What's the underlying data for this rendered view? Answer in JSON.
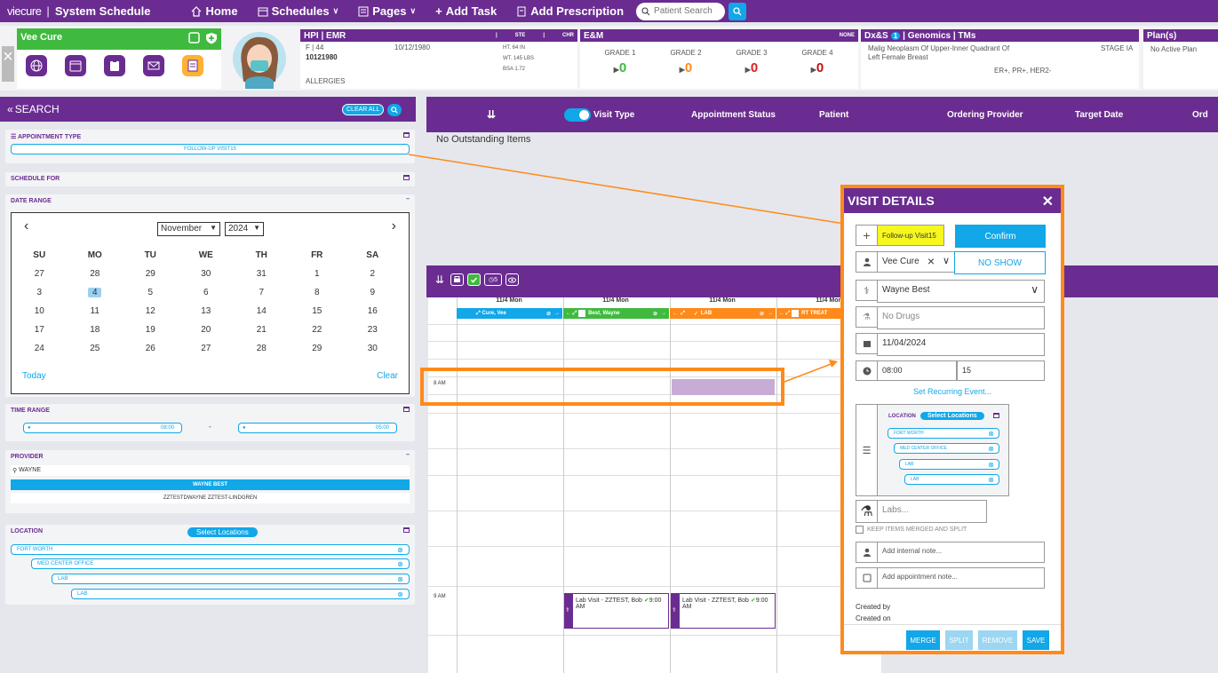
{
  "nav": {
    "logo": "viecure",
    "title": "System Schedule",
    "home": "Home",
    "schedules": "Schedules",
    "pages": "Pages",
    "add_task": "Add Task",
    "add_prescription": "Add Prescription",
    "search_placeholder": "Patient Search"
  },
  "patient": {
    "name": "Vee Cure",
    "hpi": {
      "title": "HPI | EMR",
      "ste": "STE",
      "chr": "CHR",
      "sex_age": "F | 44",
      "dob": "10/12/1980",
      "mrn": "10121980",
      "height": "HT. 64 IN",
      "weight": "WT. 145 LBS",
      "bsa": "BSA 1.72",
      "allergies": "ALLERGIES"
    },
    "em": {
      "title": "E&M",
      "none": "NONE",
      "grades": [
        {
          "label": "GRADE 1",
          "value": "0",
          "color": "#3fba3f"
        },
        {
          "label": "GRADE 2",
          "value": "0",
          "color": "#ff8a1a"
        },
        {
          "label": "GRADE 3",
          "value": "0",
          "color": "#e02020"
        },
        {
          "label": "GRADE 4",
          "value": "0",
          "color": "#c41010"
        }
      ]
    },
    "dx": {
      "title_a": "Dx&S",
      "badge": "1",
      "title_b": "| Genomics | TMs",
      "diagnosis_1": "Malig Neoplasm Of Upper-Inner Quadrant Of",
      "diagnosis_2": "Left Female Breast",
      "stage": "STAGE IA",
      "markers": "ER+, PR+, HER2-"
    },
    "plans": {
      "title": "Plan(s)",
      "value": "No Active Plan"
    }
  },
  "search": {
    "title": "SEARCH",
    "clear_all": "CLEAR ALL",
    "appointment_type": {
      "label": "APPOINTMENT TYPE",
      "value": "FOLLOW-UP VISIT15"
    },
    "schedule_for": {
      "label": "SCHEDULE FOR"
    },
    "date_range": {
      "label": "DATE RANGE",
      "month": "November",
      "year": "2024",
      "days": [
        "SU",
        "MO",
        "TU",
        "WE",
        "TH",
        "FR",
        "SA"
      ],
      "weeks": [
        [
          "27",
          "28",
          "29",
          "30",
          "31",
          "1",
          "2"
        ],
        [
          "3",
          "4",
          "5",
          "6",
          "7",
          "8",
          "9"
        ],
        [
          "10",
          "11",
          "12",
          "13",
          "14",
          "15",
          "16"
        ],
        [
          "17",
          "18",
          "19",
          "20",
          "21",
          "22",
          "23"
        ],
        [
          "24",
          "25",
          "26",
          "27",
          "28",
          "29",
          "30"
        ]
      ],
      "today": "Today",
      "clear": "Clear",
      "selected": "4"
    },
    "time_range": {
      "label": "TIME RANGE",
      "start": "08:00",
      "dash": "-",
      "end": "05:00"
    },
    "provider": {
      "label": "PROVIDER",
      "query": "WAYNE",
      "selected": "WAYNE BEST",
      "other": "ZZTESTDWAYNE ZZTEST-LINDGREN"
    },
    "location": {
      "label": "LOCATION",
      "select_btn": "Select Locations",
      "items": [
        "FORT WORTH",
        "MED CENTER OFFICE",
        "LAB",
        "LAB"
      ]
    }
  },
  "queue": {
    "visit_type": "Visit Type",
    "appointment_status": "Appointment Status",
    "patient": "Patient",
    "ordering_provider": "Ordering Provider",
    "target_date": "Target Date",
    "ord": "Ord",
    "empty": "No Outstanding Items"
  },
  "schedule": {
    "badge": "5",
    "columns": [
      {
        "date": "11/4 Mon",
        "name": "Cure, Vee",
        "color": "#11a7e8"
      },
      {
        "date": "11/4 Mon",
        "name": "Best, Wayne",
        "color": "#3fba3f"
      },
      {
        "date": "11/4 Mon",
        "name": "LAB",
        "color": "#ff8a1a"
      },
      {
        "date": "11/4 Mon",
        "name": "RT TREAT",
        "color": "#ff8a1a"
      }
    ],
    "time_8": "8 AM",
    "time_9": "9 AM",
    "events": [
      {
        "title": "Lab Visit - ZZTEST, Bob",
        "time": "9:00",
        "ampm": "AM"
      },
      {
        "title": "Lab Visit - ZZTEST, Bob",
        "time": "9:00",
        "ampm": "AM"
      }
    ]
  },
  "visit": {
    "title": "VISIT DETAILS",
    "type": "Follow-up Visit15",
    "confirm": "Confirm",
    "patient": "Vee Cure",
    "no_show": "NO SHOW",
    "provider": "Wayne Best",
    "drugs_placeholder": "No Drugs",
    "date": "11/04/2024",
    "time": "08:00",
    "duration": "15",
    "recurring": "Set Recurring Event...",
    "location_label": "LOCATION",
    "select_locations": "Select Locations",
    "locations": [
      "FORT WORTH",
      "MED CENTER OFFICE",
      "LAB",
      "LAB"
    ],
    "labs_placeholder": "Labs...",
    "keep_items": "KEEP ITEMS MERGED AND SPLIT",
    "internal_note_placeholder": "Add internal note...",
    "appointment_note_placeholder": "Add appointment note...",
    "created_by": "Created by",
    "created_on": "Created on",
    "merge": "MERGE",
    "split": "SPLIT",
    "remove": "REMOVE",
    "save": "SAVE"
  }
}
